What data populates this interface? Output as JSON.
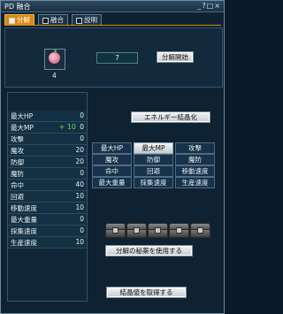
{
  "window": {
    "title": "PD 融合",
    "controls": "_?□×"
  },
  "tabs": [
    {
      "label": "分解",
      "active": true
    },
    {
      "label": "融合",
      "active": false
    },
    {
      "label": "説明",
      "active": false
    }
  ],
  "disassemble": {
    "item_icon": "peach-icon",
    "item_count": "4",
    "quantity": "7",
    "start_button": "分解開始"
  },
  "energy_button": "エネルギー結晶化",
  "stats": [
    {
      "label": "最大HP",
      "value": "0",
      "bonus": ""
    },
    {
      "label": "最大MP",
      "value": "0",
      "bonus": "+ 10"
    },
    {
      "label": "攻撃",
      "value": "0",
      "bonus": ""
    },
    {
      "label": "魔攻",
      "value": "20",
      "bonus": ""
    },
    {
      "label": "防御",
      "value": "20",
      "bonus": ""
    },
    {
      "label": "魔防",
      "value": "0",
      "bonus": ""
    },
    {
      "label": "命中",
      "value": "40",
      "bonus": ""
    },
    {
      "label": "回避",
      "value": "10",
      "bonus": ""
    },
    {
      "label": "移動速度",
      "value": "10",
      "bonus": ""
    },
    {
      "label": "最大重量",
      "value": "0",
      "bonus": ""
    },
    {
      "label": "採集速度",
      "value": "0",
      "bonus": ""
    },
    {
      "label": "生産速度",
      "value": "10",
      "bonus": ""
    }
  ],
  "stat_grid": [
    {
      "label": "最大HP",
      "selected": false
    },
    {
      "label": "最大MP",
      "selected": true
    },
    {
      "label": "攻撃",
      "selected": false
    },
    {
      "label": "魔攻",
      "selected": false
    },
    {
      "label": "防御",
      "selected": false
    },
    {
      "label": "魔防",
      "selected": false
    },
    {
      "label": "命中",
      "selected": false
    },
    {
      "label": "回避",
      "selected": false
    },
    {
      "label": "移動速度",
      "selected": false
    },
    {
      "label": "最大重量",
      "selected": false
    },
    {
      "label": "採集速度",
      "selected": false
    },
    {
      "label": "生産速度",
      "selected": false
    }
  ],
  "chests": [
    "chest-icon",
    "chest-icon",
    "chest-icon",
    "chest-icon",
    "chest-icon"
  ],
  "secret_medicine_button": "分解の秘薬を使用する",
  "crystal_button": "結晶値を取得する",
  "colors": {
    "accent": "#d88a16",
    "panel": "#102637",
    "bonus": "#5ee05e"
  }
}
